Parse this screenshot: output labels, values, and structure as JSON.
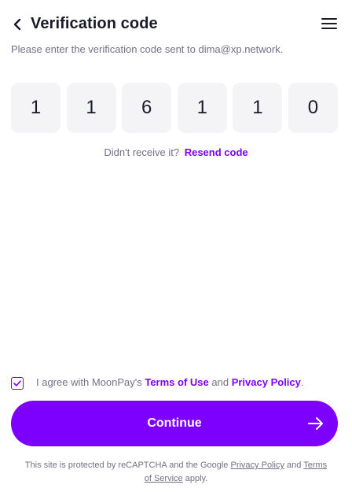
{
  "header": {
    "title": "Verification code"
  },
  "subtitle": "Please enter the verification code sent to dima@xp.network.",
  "code": {
    "digits": [
      "1",
      "1",
      "6",
      "1",
      "1",
      "0"
    ]
  },
  "resend": {
    "prompt": "Didn't receive it?",
    "link": "Resend code"
  },
  "agree": {
    "checked": true,
    "prefix": "I agree with MoonPay's",
    "terms": "Terms of Use",
    "and": "and",
    "privacy": "Privacy Policy",
    "suffix": "."
  },
  "continue": {
    "label": "Continue"
  },
  "recaptcha": {
    "prefix": "This site is protected by reCAPTCHA and the Google",
    "privacy": "Privacy Policy",
    "and": "and",
    "terms": "Terms of Service",
    "suffix": "apply."
  },
  "icons": {
    "back": "chevron-left-icon",
    "menu": "hamburger-menu-icon",
    "check": "checkmark-icon",
    "arrow": "arrow-right-icon"
  },
  "colors": {
    "accent": "#7d00ff",
    "code_box_bg": "#f4f4f6",
    "muted_text": "#727186"
  }
}
